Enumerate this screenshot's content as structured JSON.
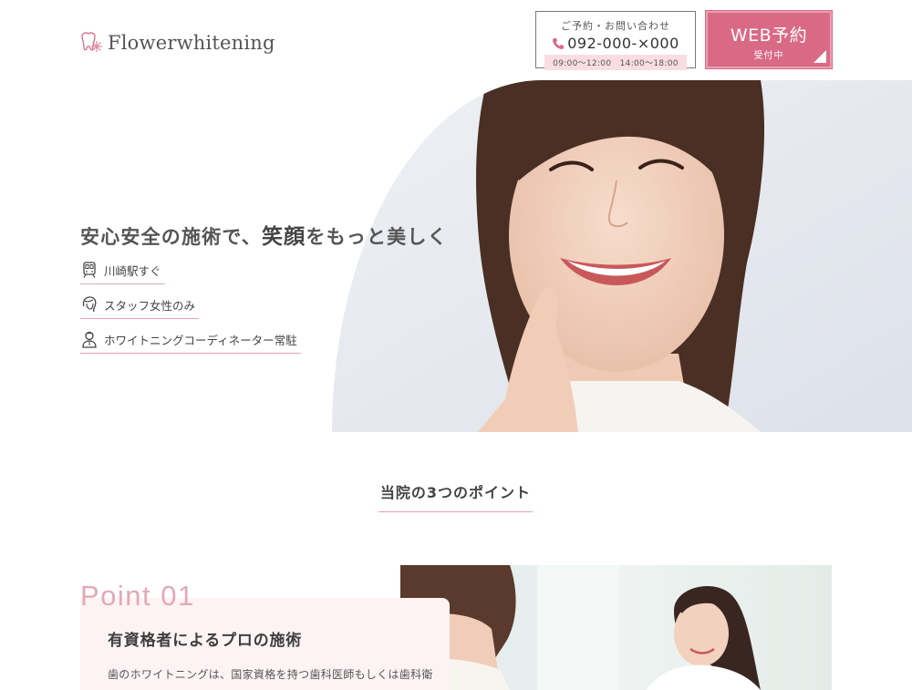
{
  "header": {
    "logo_text": "Flowerwhitening",
    "logo_icon": "tooth-flower-icon",
    "contact": {
      "label": "ご予約・お問い合わせ",
      "phone_icon": "phone-icon",
      "phone": "092-000-×000",
      "hours": "09:00〜12:00　14:00〜18:00"
    },
    "web_reservation": {
      "main": "WEB予約",
      "sub": "受付中"
    }
  },
  "hero": {
    "headline_part1": "安心安全の施術で、",
    "headline_accent": "笑顔",
    "headline_part2": "をもっと美しく",
    "features": [
      {
        "icon": "train-icon",
        "label": "川崎駅すぐ"
      },
      {
        "icon": "woman-hair-icon",
        "label": "スタッフ女性のみ"
      },
      {
        "icon": "coordinator-icon",
        "label": "ホワイトニングコーディネーター常駐"
      }
    ]
  },
  "points": {
    "title": "当院の3つのポイント",
    "items": [
      {
        "number": "Point 01",
        "heading": "有資格者によるプロの施術",
        "body": "歯のホワイトニングは、国家資格を持つ歯科医師もしくは歯科衛"
      }
    ]
  },
  "colors": {
    "accent_pink": "#d96a86",
    "light_pink": "#f9dde3",
    "underline_pink": "#e6a3b5",
    "point_number": "#e4a8b7"
  }
}
